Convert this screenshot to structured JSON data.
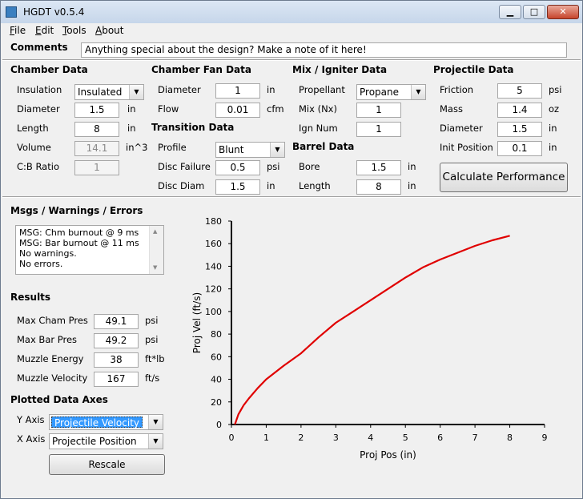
{
  "window": {
    "title": "HGDT v0.5.4",
    "min_glyph": "▁",
    "max_glyph": "□",
    "close_glyph": "✕"
  },
  "menu": {
    "file_u": "F",
    "file_rest": "ile",
    "edit_u": "E",
    "edit_rest": "dit",
    "tools_u": "T",
    "tools_rest": "ools",
    "about_u": "A",
    "about_rest": "bout"
  },
  "comments": {
    "label": "Comments",
    "value": "Anything special about the design?  Make a note of it here!"
  },
  "chamber": {
    "title": "Chamber Data",
    "insulation_label": "Insulation",
    "insulation_value": "Insulated",
    "diameter_label": "Diameter",
    "diameter_value": "1.5",
    "diameter_unit": "in",
    "length_label": "Length",
    "length_value": "8",
    "length_unit": "in",
    "volume_label": "Volume",
    "volume_value": "14.1",
    "volume_unit": "in^3",
    "cb_label": "C:B Ratio",
    "cb_value": "1"
  },
  "fan": {
    "title": "Chamber Fan Data",
    "diameter_label": "Diameter",
    "diameter_value": "1",
    "diameter_unit": "in",
    "flow_label": "Flow",
    "flow_value": "0.01",
    "flow_unit": "cfm"
  },
  "transition": {
    "title": "Transition Data",
    "profile_label": "Profile",
    "profile_value": "Blunt",
    "disc_failure_label": "Disc Failure",
    "disc_failure_value": "0.5",
    "disc_failure_unit": "psi",
    "disc_diam_label": "Disc Diam",
    "disc_diam_value": "1.5",
    "disc_diam_unit": "in"
  },
  "mix": {
    "title": "Mix / Igniter Data",
    "propellant_label": "Propellant",
    "propellant_value": "Propane",
    "mix_label": "Mix (Nx)",
    "mix_value": "1",
    "ign_label": "Ign Num",
    "ign_value": "1"
  },
  "barrel": {
    "title": "Barrel Data",
    "bore_label": "Bore",
    "bore_value": "1.5",
    "bore_unit": "in",
    "length_label": "Length",
    "length_value": "8",
    "length_unit": "in"
  },
  "projectile": {
    "title": "Projectile Data",
    "friction_label": "Friction",
    "friction_value": "5",
    "friction_unit": "psi",
    "mass_label": "Mass",
    "mass_value": "1.4",
    "mass_unit": "oz",
    "diameter_label": "Diameter",
    "diameter_value": "1.5",
    "diameter_unit": "in",
    "init_label": "Init Position",
    "init_value": "0.1",
    "init_unit": "in"
  },
  "calculate_label": "Calculate Performance",
  "messages": {
    "title": "Msgs / Warnings / Errors",
    "lines": [
      "MSG: Chm burnout @ 9 ms",
      "MSG: Bar burnout @ 11 ms",
      "No warnings.",
      "No errors."
    ]
  },
  "results": {
    "title": "Results",
    "max_cham_label": "Max Cham Pres",
    "max_cham_value": "49.1",
    "max_cham_unit": "psi",
    "max_bar_label": "Max Bar Pres",
    "max_bar_value": "49.2",
    "max_bar_unit": "psi",
    "muzzle_energy_label": "Muzzle Energy",
    "muzzle_energy_value": "38",
    "muzzle_energy_unit": "ft*lb",
    "muzzle_velocity_label": "Muzzle Velocity",
    "muzzle_velocity_value": "167",
    "muzzle_velocity_unit": "ft/s"
  },
  "axes": {
    "title": "Plotted Data Axes",
    "y_label": "Y Axis",
    "y_value": "Projectile Velocity",
    "x_label": "X Axis",
    "x_value": "Projectile Position",
    "rescale_label": "Rescale"
  },
  "colors": {
    "curve": "#e00000",
    "selection": "#3399ff"
  },
  "chart_data": {
    "type": "line",
    "xlabel": "Proj Pos (in)",
    "ylabel": "Proj Vel (ft/s)",
    "xlim": [
      0,
      9
    ],
    "ylim": [
      0,
      180
    ],
    "xticks": [
      0,
      1,
      2,
      3,
      4,
      5,
      6,
      7,
      8,
      9
    ],
    "yticks": [
      0,
      20,
      40,
      60,
      80,
      100,
      120,
      140,
      160,
      180
    ],
    "grid": false,
    "series": [
      {
        "color": "#e00000",
        "x": [
          0.1,
          0.2,
          0.35,
          0.5,
          0.75,
          1.0,
          1.5,
          2.0,
          2.5,
          3.0,
          3.5,
          4.0,
          4.5,
          5.0,
          5.5,
          6.0,
          6.5,
          7.0,
          7.5,
          8.0
        ],
        "y": [
          0,
          9,
          17,
          23,
          32,
          40,
          52,
          63,
          77,
          90,
          100,
          110,
          120,
          130,
          139,
          146,
          152,
          158,
          163,
          167
        ]
      }
    ]
  }
}
